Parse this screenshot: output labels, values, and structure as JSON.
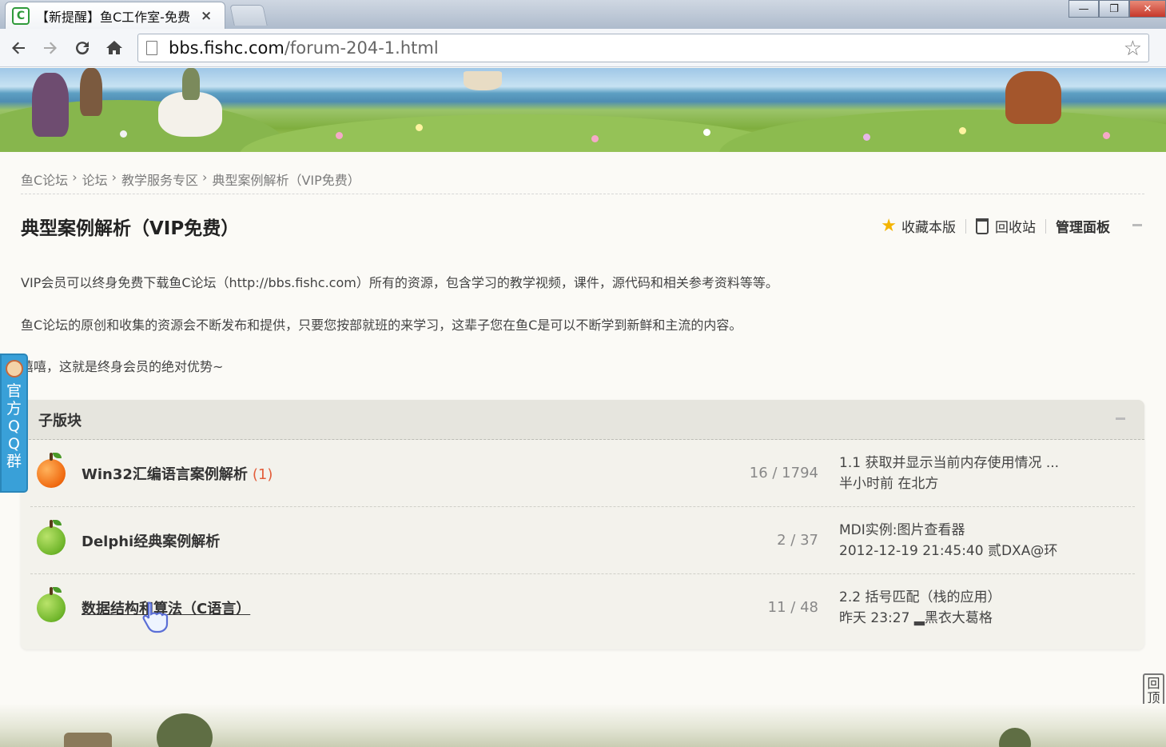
{
  "browser": {
    "tab_title": "【新提醒】鱼C工作室-免费",
    "tab_close": "×",
    "favicon_letter": "C",
    "url_host": "bbs.fishc.com",
    "url_path": "/forum-204-1.html",
    "win_min": "—",
    "win_restore": "❐",
    "win_close": "✕"
  },
  "breadcrumb": [
    "鱼C论坛",
    "论坛",
    "教学服务专区",
    "典型案例解析（VIP免费）"
  ],
  "breadcrumb_sep": "›",
  "forum": {
    "title": "典型案例解析（VIP免费）",
    "favorite_label": "收藏本版",
    "recycle_label": "回收站",
    "manage_label": "管理面板"
  },
  "description": [
    "VIP会员可以终身免费下载鱼C论坛（http://bbs.fishc.com）所有的资源，包含学习的教学视频，课件，源代码和相关参考资料等等。",
    "鱼C论坛的原创和收集的资源会不断发布和提供，只要您按部就班的来学习，这辈子您在鱼C是可以不断学到新鲜和主流的内容。",
    "嘻嘻，这就是终身会员的绝对优势~"
  ],
  "subforums": {
    "header": "子版块",
    "rows": [
      {
        "name": "Win32汇编语言案例解析",
        "new_count": "(1)",
        "counts": "16 / 1794",
        "last_title": "1.1 获取并显示当前内存使用情况 ...",
        "last_meta": "半小时前 在北方",
        "icon": "orange-fruit-icon"
      },
      {
        "name": "Delphi经典案例解析",
        "new_count": "",
        "counts": "2 / 37",
        "last_title": "MDI实例:图片查看器",
        "last_meta": "2012-12-19 21:45:40 贰DXA@环",
        "icon": "green-apple-icon"
      },
      {
        "name": "数据结构和算法（C语言）",
        "new_count": "",
        "counts": "11 / 48",
        "last_title": "2.2 括号匹配（栈的应用）",
        "last_meta": "昨天 23:27 ▂黑衣大葛格",
        "icon": "green-apple-icon"
      }
    ]
  },
  "side": {
    "qq_label": "官方QQ群",
    "backtop_label": "回顶部"
  },
  "colors": {
    "accent_blue": "#39a0d8",
    "new_count": "#e35d3a",
    "favorite_star": "#f4b400"
  }
}
